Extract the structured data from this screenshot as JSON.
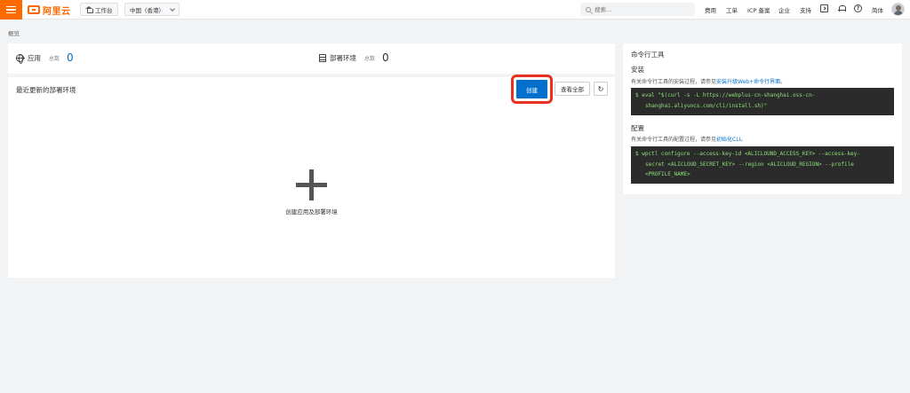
{
  "header": {
    "logo_text": "阿里云",
    "workbench_label": "工作台",
    "region_label": "中国（香港）",
    "search_placeholder": "搜索...",
    "nav": {
      "billing": "费用",
      "ticket": "工单",
      "icp": "ICP 备案",
      "enterprise": "企业",
      "support": "支持",
      "language": "简体"
    },
    "icons": [
      "menu-icon",
      "home-icon",
      "search-icon",
      "terminal-icon",
      "bell-icon",
      "help-icon",
      "avatar"
    ]
  },
  "breadcrumb": "概览",
  "stats": {
    "apps_label": "应用",
    "apps_total_label": "总数",
    "apps_total": "0",
    "envs_label": "部署环境",
    "envs_total_label": "总数",
    "envs_total": "0"
  },
  "envs_panel": {
    "title": "最近更新的部署环境",
    "create_label": "创建",
    "view_all_label": "查看全部",
    "refresh_glyph": "↻",
    "empty_label": "创建应用及部署环境"
  },
  "cli": {
    "title": "命令行工具",
    "install_heading": "安装",
    "install_desc_prefix": "有关命令行工具的安装过程，请参见",
    "install_link": "安装升级Web+命令行界面",
    "install_desc_suffix": "。",
    "install_code_line1": "$ eval \"$(curl -s -L https://webplus-cn-shanghai.oss-cn-",
    "install_code_line2": "shanghai.aliyuncs.com/cli/install.sh)\"",
    "config_heading": "配置",
    "config_desc_prefix": "有关命令行工具的配置过程，请参见",
    "config_link": "初始化CLI",
    "config_desc_suffix": "。",
    "config_code_line1": "$ wpctl configure --access-key-id <ALICLOUND_ACCESS_KEY> --access-key-",
    "config_code_line2": "secret <ALICLOUD_SECRET_KEY> --region <ALICLOUD_REGION> --profile",
    "config_code_line3": "<PROFILE_NAME>"
  },
  "colors": {
    "brand": "#ff6a00",
    "primary": "#0070cc",
    "highlight": "#e8321f",
    "code_bg": "#2b2b2b",
    "code_text": "#8ce07a"
  }
}
